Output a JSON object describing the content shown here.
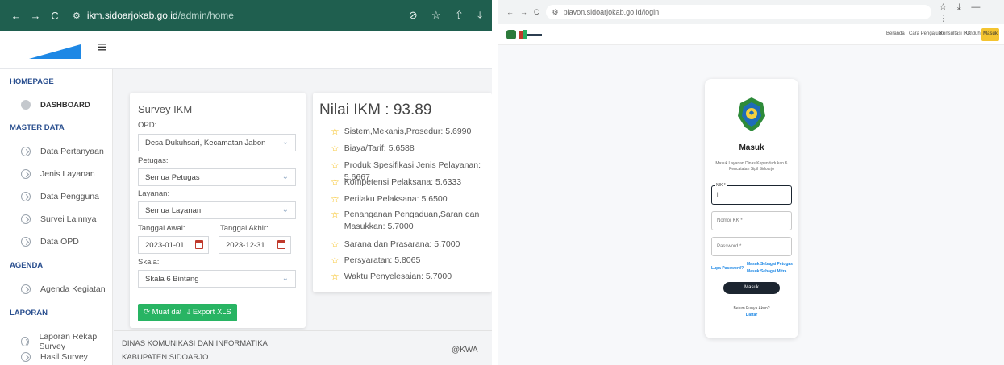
{
  "left": {
    "browser": {
      "url_host": "ikm.sidoarjokab.go.id",
      "url_path": "/admin/home",
      "nav_back": "←",
      "nav_forward": "→",
      "nav_reload": "C",
      "tools": [
        "⊘",
        "☆",
        "⇧",
        "⤓"
      ]
    },
    "sidebar": {
      "homepage": "HOMEPAGE",
      "dashboard": "DASHBOARD",
      "master_data": "MASTER DATA",
      "master_items": [
        "Data Pertanyaan",
        "Jenis Layanan",
        "Data Pengguna",
        "Survei Lainnya",
        "Data OPD"
      ],
      "agenda": "AGENDA",
      "agenda_items": [
        "Agenda Kegiatan"
      ],
      "laporan": "LAPORAN",
      "laporan_items": [
        "Laporan Rekap Survey",
        "Hasil Survey"
      ]
    },
    "survey": {
      "title": "Survey IKM",
      "opd_label": "OPD:",
      "opd_value": "Desa Dukuhsari, Kecamatan Jabon",
      "petugas_label": "Petugas:",
      "petugas_value": "Semua Petugas",
      "layanan_label": "Layanan:",
      "layanan_value": "Semua Layanan",
      "tgl_awal_label": "Tanggal Awal:",
      "tgl_awal_value": "2023-01-01",
      "tgl_akhir_label": "Tanggal Akhir:",
      "tgl_akhir_value": "2023-12-31",
      "skala_label": "Skala:",
      "skala_value": "Skala 6 Bintang",
      "muat_button": "Muat data",
      "export_button": "Export XLS"
    },
    "ikm": {
      "title": "Nilai IKM : 93.89",
      "items": [
        "Sistem,Mekanis,Prosedur: 5.6990",
        "Biaya/Tarif: 5.6588",
        "Produk Spesifikasi Jenis Pelayanan: 5.6667",
        "Kompetensi Pelaksana: 5.6333",
        "Perilaku Pelaksana: 5.6500",
        "Penanganan Pengaduan,Saran dan Masukkan: 5.7000",
        "Sarana dan Prasarana: 5.7000",
        "Persyaratan: 5.8065",
        "Waktu Penyelesaian: 5.7000"
      ]
    },
    "footer": {
      "line1": "DINAS KOMUNIKASI DAN INFORMATIKA",
      "line2": "KABUPATEN SIDOARJO",
      "right": "@KWA"
    }
  },
  "right": {
    "browser": {
      "url": "plavon.sidoarjokab.go.id/login",
      "tools": [
        "☆",
        "⤓",
        "—",
        "⋮"
      ]
    },
    "nav": [
      "Beranda",
      "Cara Pengajuan",
      "Konsultasi IKK",
      "Unduh"
    ],
    "nav_button": "Masuk",
    "login": {
      "title": "Masuk",
      "subtitle": "Masuk Layanan Dinas Kependudukan & Pencatatan Sipil Sidoarjo",
      "nik_label": "NIK *",
      "kk_placeholder": "Nomor KK *",
      "password_placeholder": "Password *",
      "lupa": "Lupa Password?",
      "petugas": "Masuk Sebagai Petugas",
      "mitra": "Masuk Sebagai Mitra",
      "button": "Masuk",
      "no_account": "Belum Punya Akun?",
      "daftar": "Daftar"
    }
  },
  "colors": {
    "dark_chrome": "#1f5f4f",
    "sidebar_heading": "#2a4f8f",
    "green_button": "#28b463",
    "star": "#f5b800",
    "accent_yellow": "#f4c430",
    "login_button": "#1c2530"
  }
}
